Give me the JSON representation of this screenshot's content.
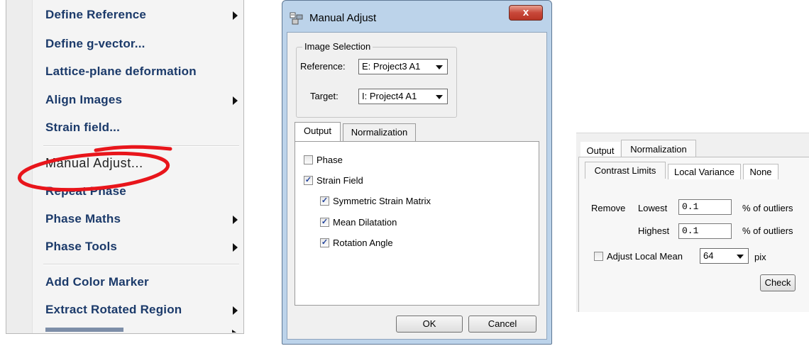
{
  "menu": {
    "items": [
      {
        "label": "Define Reference",
        "submenu": true
      },
      {
        "label": "Define g-vector...",
        "submenu": false
      },
      {
        "label": "Lattice-plane deformation",
        "submenu": false
      },
      {
        "label": "Align Images",
        "submenu": true
      },
      {
        "label": "Strain field...",
        "submenu": false
      },
      {
        "label": "Manual Adjust...",
        "submenu": false,
        "highlighted": true
      },
      {
        "label": "Repeat Phase",
        "submenu": false
      },
      {
        "label": "Phase Maths",
        "submenu": true
      },
      {
        "label": "Phase Tools",
        "submenu": true
      },
      {
        "label": "Add Color Marker",
        "submenu": false
      },
      {
        "label": "Extract Rotated Region",
        "submenu": true
      }
    ],
    "annotation_color": "#e8151b"
  },
  "dialog": {
    "title": "Manual Adjust",
    "close_label": "x",
    "image_selection": {
      "legend": "Image Selection",
      "reference_label": "Reference:",
      "reference_value": "E: Project3 A1",
      "target_label": "Target:",
      "target_value": "I: Project4 A1"
    },
    "tabs": [
      "Output",
      "Normalization"
    ],
    "output": {
      "phase": {
        "label": "Phase",
        "checked": false
      },
      "strain_field": {
        "label": "Strain Field",
        "checked": true
      },
      "symmetric": {
        "label": "Symmetric Strain Matrix",
        "checked": true
      },
      "dilatation": {
        "label": "Mean Dilatation",
        "checked": true
      },
      "rotation": {
        "label": "Rotation Angle",
        "checked": true
      }
    },
    "ok_label": "OK",
    "cancel_label": "Cancel"
  },
  "norm_panel": {
    "tabs": [
      "Output",
      "Normalization"
    ],
    "subtabs": [
      "Contrast Limits",
      "Local Variance",
      "None"
    ],
    "remove_label": "Remove",
    "lowest_label": "Lowest",
    "lowest_value": "0.1",
    "highest_label": "Highest",
    "highest_value": "0.1",
    "outliers_label": "% of outliers",
    "adjust_mean_label": "Adjust Local Mean",
    "adjust_mean_checked": false,
    "mean_value": "64",
    "pix_label": "pix",
    "check_label": "Check"
  }
}
